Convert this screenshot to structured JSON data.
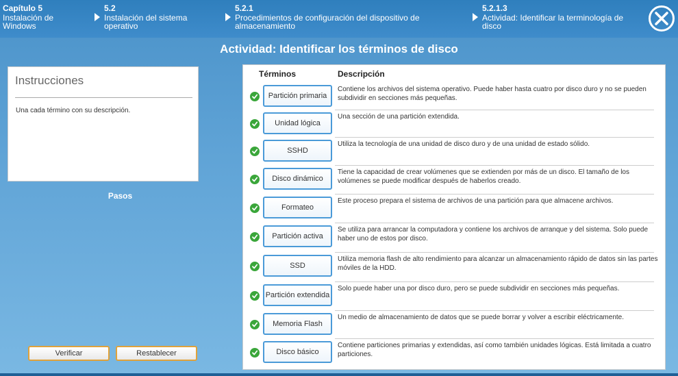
{
  "breadcrumbs": [
    {
      "num": "Capítulo 5",
      "text": "Instalación de Windows"
    },
    {
      "num": "5.2",
      "text": "Instalación del sistema operativo"
    },
    {
      "num": "5.2.1",
      "text": "Procedimientos de configuración del dispositivo de almacenamiento"
    },
    {
      "num": "5.2.1.3",
      "text": "Actividad: Identificar la terminología de disco"
    }
  ],
  "close_icon": "close-icon",
  "title": "Actividad: Identificar los términos de disco",
  "instructions": {
    "heading": "Instrucciones",
    "text": "Una cada término con su descripción."
  },
  "pasos": "Pasos",
  "buttons": {
    "verify": "Verificar",
    "reset": "Restablecer"
  },
  "table": {
    "col_terms": "Términos",
    "col_desc": "Descripción",
    "rows": [
      {
        "term": "Partición primaria",
        "desc": "Contiene los archivos del sistema operativo. Puede haber hasta cuatro por disco duro y no se pueden subdividir en secciones más pequeñas."
      },
      {
        "term": "Unidad lógica",
        "desc": "Una sección de una partición extendida."
      },
      {
        "term": "SSHD",
        "desc": "Utiliza la tecnología de una unidad de disco duro y de una unidad de estado sólido."
      },
      {
        "term": "Disco dinámico",
        "desc": "Tiene la capacidad de crear volúmenes que se extienden por más de un disco. El tamaño de los volúmenes se puede modificar después de haberlos creado."
      },
      {
        "term": "Formateo",
        "desc": "Este proceso prepara el sistema de archivos de una partición para que almacene archivos."
      },
      {
        "term": "Partición activa",
        "desc": "Se utiliza para arrancar la computadora y contiene los archivos de arranque y del sistema. Solo puede haber uno de estos por disco."
      },
      {
        "term": "SSD",
        "desc": "Utiliza memoria flash de alto rendimiento para alcanzar un almacenamiento rápido de datos sin las partes móviles de la HDD."
      },
      {
        "term": "Partición extendida",
        "desc": "Solo puede haber una por disco duro, pero se puede subdividir en secciones más pequeñas."
      },
      {
        "term": "Memoria Flash",
        "desc": "Un medio de almacenamiento de datos que se puede borrar y volver a escribir eléctricamente."
      },
      {
        "term": "Disco básico",
        "desc": "Contiene particiones primarias y extendidas, así como también unidades lógicas. Está limitada a cuatro particiones."
      }
    ]
  },
  "colors": {
    "accent": "#4a9ad8",
    "check": "#3aa63a",
    "button_border": "#e0a23a"
  }
}
